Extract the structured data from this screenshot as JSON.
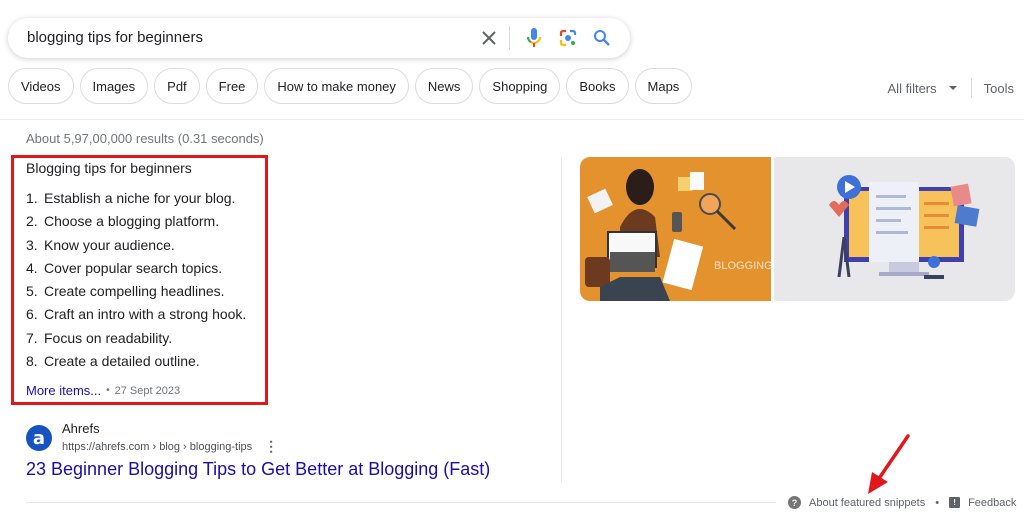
{
  "search": {
    "query": "blogging tips for beginners",
    "icons": [
      "clear-icon",
      "microphone-icon",
      "google-lens-icon",
      "search-icon"
    ]
  },
  "chips": [
    "Videos",
    "Images",
    "Pdf",
    "Free",
    "How to make money",
    "News",
    "Shopping",
    "Books",
    "Maps"
  ],
  "filters": {
    "all_filters": "All filters",
    "tools": "Tools"
  },
  "results_stats": "About 5,97,00,000 results (0.31 seconds)",
  "featured_snippet": {
    "title": "Blogging tips for beginners",
    "items": [
      {
        "n": "1.",
        "text": "Establish a niche for your blog."
      },
      {
        "n": "2.",
        "text": "Choose a blogging platform."
      },
      {
        "n": "3.",
        "text": "Know your audience."
      },
      {
        "n": "4.",
        "text": "Cover popular search topics."
      },
      {
        "n": "5.",
        "text": "Create compelling headlines."
      },
      {
        "n": "6.",
        "text": "Craft an intro with a strong hook."
      },
      {
        "n": "7.",
        "text": "Focus on readability."
      },
      {
        "n": "8.",
        "text": "Create a detailed outline."
      }
    ],
    "more_items": "More items...",
    "separator": "•",
    "date": "27 Sept 2023",
    "highlight_color": "#e2171c"
  },
  "images": {
    "image1_label": "BLOGGING",
    "image1_color": "#e3922e",
    "image2_color": "#e8e8ea"
  },
  "source": {
    "favicon_letter": "a",
    "name": "Ahrefs",
    "url": "https://ahrefs.com › blog › blogging-tips",
    "title": "23 Beginner Blogging Tips to Get Better at Blogging (Fast)"
  },
  "footer": {
    "about": "About featured snippets",
    "separator": "•",
    "feedback": "Feedback"
  },
  "colors": {
    "link": "#1a0dab",
    "annotation_arrow": "#e2171c"
  }
}
